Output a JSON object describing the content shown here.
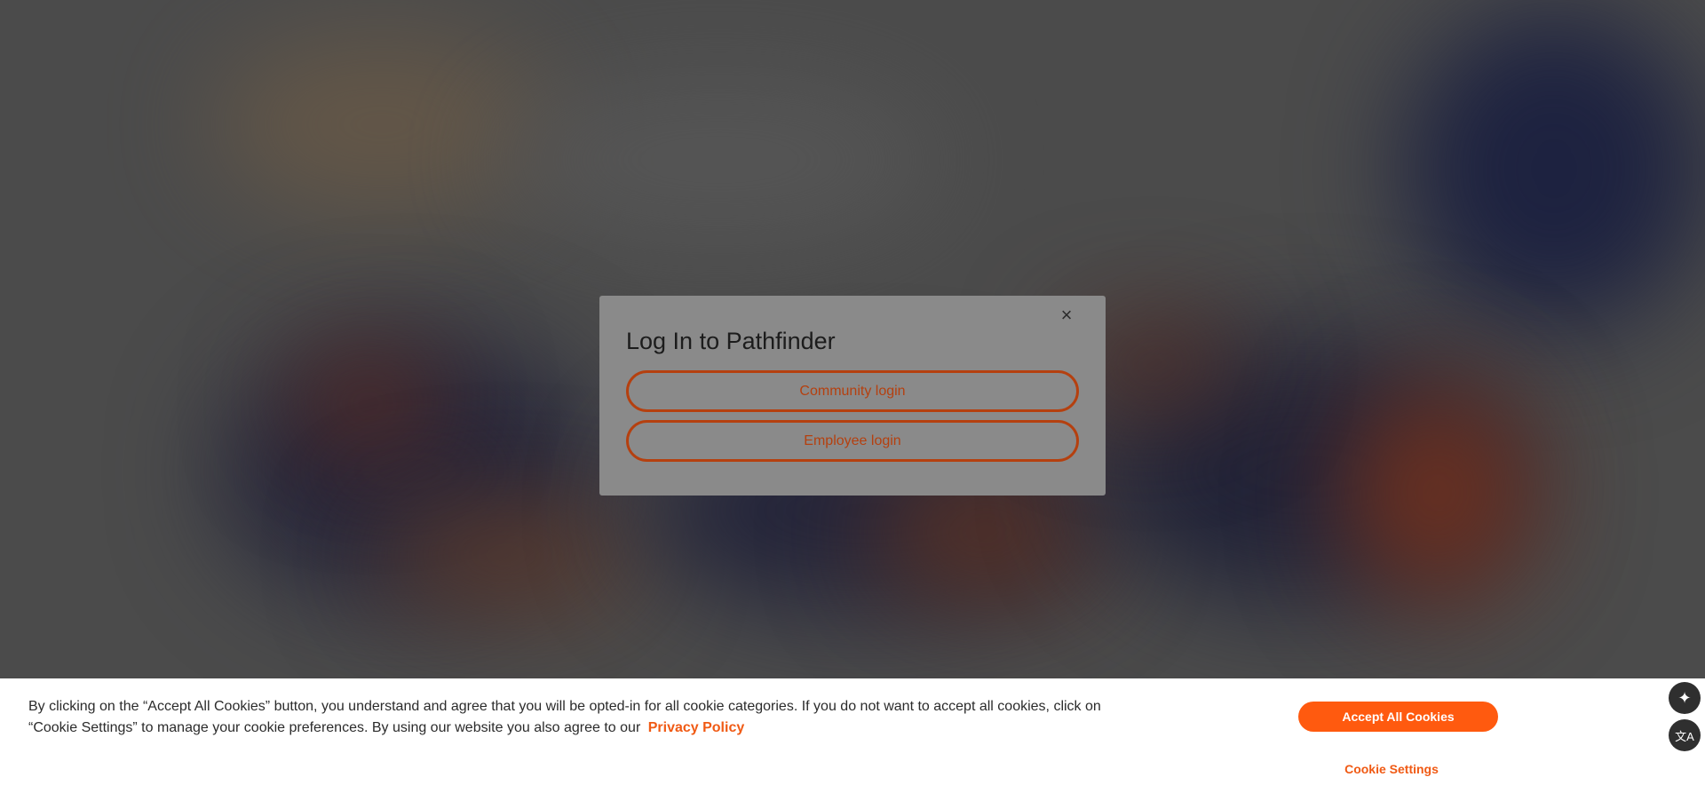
{
  "modal": {
    "title": "Log In to Pathfinder",
    "close_icon": "×",
    "community_button": "Community login",
    "employee_button": "Employee login"
  },
  "cookie_banner": {
    "text": "By clicking on the “Accept All Cookies” button, you understand and agree that you will be opted-in for all cookie categories. If you do not want to accept all cookies, click on “Cookie Settings” to manage your cookie preferences. By using our website you also agree to our",
    "privacy_link": "Privacy Policy",
    "accept_button": "Accept All Cookies",
    "settings_link": "Cookie Settings"
  },
  "side_buttons": {
    "ai_icon": "✦",
    "translate_icon": "文A"
  },
  "colors": {
    "accent": "#ff5a0f",
    "overlay": "#4a4a4a",
    "modal_bg": "#8a8a8a"
  }
}
